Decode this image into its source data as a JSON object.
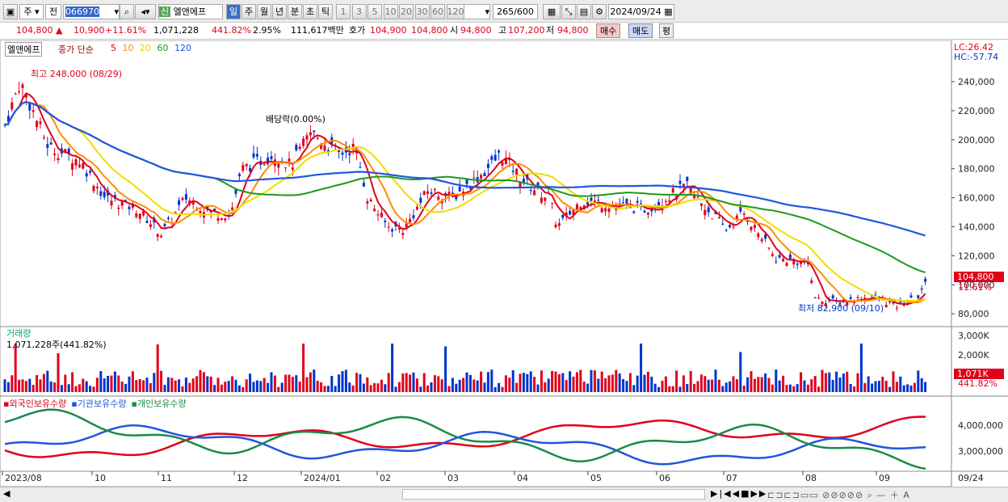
{
  "toolbar": {
    "market": "주",
    "kind": "전",
    "code": "066970",
    "name": "엘앤에프",
    "new_badge": "신",
    "periods": [
      "일",
      "주",
      "월",
      "년",
      "분",
      "초",
      "틱"
    ],
    "nums": [
      "1",
      "3",
      "5",
      "10",
      "20",
      "30",
      "60",
      "120"
    ],
    "count": "265",
    "count_total": "/600",
    "date": "2024/09/24"
  },
  "quote": {
    "price": "104,800 ▲",
    "change": "10,900",
    "pct": "+11.61%",
    "volume": "1,071,228",
    "vol_ratio": "441.82%",
    "turnover_rate": "2.95%",
    "amount": "111,617백만",
    "ask_label": "호가",
    "ask": "104,900",
    "bid": "104,800",
    "open_label": "시",
    "open": "94,800",
    "high_label": "고",
    "high": "107,200",
    "low_label": "저",
    "low": "94,800",
    "buy": "매수",
    "sell": "매도",
    "avg": "평"
  },
  "price_panel": {
    "name": "엘앤에프",
    "ma_label": "종가 단순",
    "ma": [
      {
        "p": "5",
        "c": "#e0001a"
      },
      {
        "p": "10",
        "c": "#ff8c00"
      },
      {
        "p": "20",
        "c": "#e6d200"
      },
      {
        "p": "60",
        "c": "#1a9a1a"
      },
      {
        "p": "120",
        "c": "#2255dd"
      }
    ],
    "lc": "LC:26.42",
    "hc": "HC:-57.74",
    "high_note": "최고 248,000 (08/29)",
    "div_note": "배당락(0.00%)",
    "low_note": "최저 82,900 (09/10)",
    "last": "104,800",
    "last_pct": "11.61%",
    "yticks": [
      "240,000",
      "220,000",
      "200,000",
      "180,000",
      "160,000",
      "140,000",
      "120,000",
      "100,000",
      "80,000"
    ]
  },
  "volume_panel": {
    "title": "거래량",
    "value": "1,071,228주(441.82%)",
    "yticks": [
      "3,000K",
      "2,000K",
      "1,000K"
    ],
    "last": "1,071K",
    "last_pct": "441.82%"
  },
  "holders_panel": {
    "items": [
      {
        "name": "외국인보유수량",
        "color": "#e0001a"
      },
      {
        "name": "기관보유수량",
        "color": "#2255dd"
      },
      {
        "name": "개인보유수량",
        "color": "#1a8a4a"
      }
    ],
    "yticks": [
      "4,000,000",
      "3,000,000"
    ]
  },
  "xaxis": [
    "2023/08",
    "10",
    "11",
    "12",
    "2024/01",
    "02",
    "03",
    "04",
    "05",
    "06",
    "07",
    "08",
    "09",
    "09/24"
  ],
  "colors": {
    "up": "#e0001a",
    "down": "#0033cc"
  }
}
